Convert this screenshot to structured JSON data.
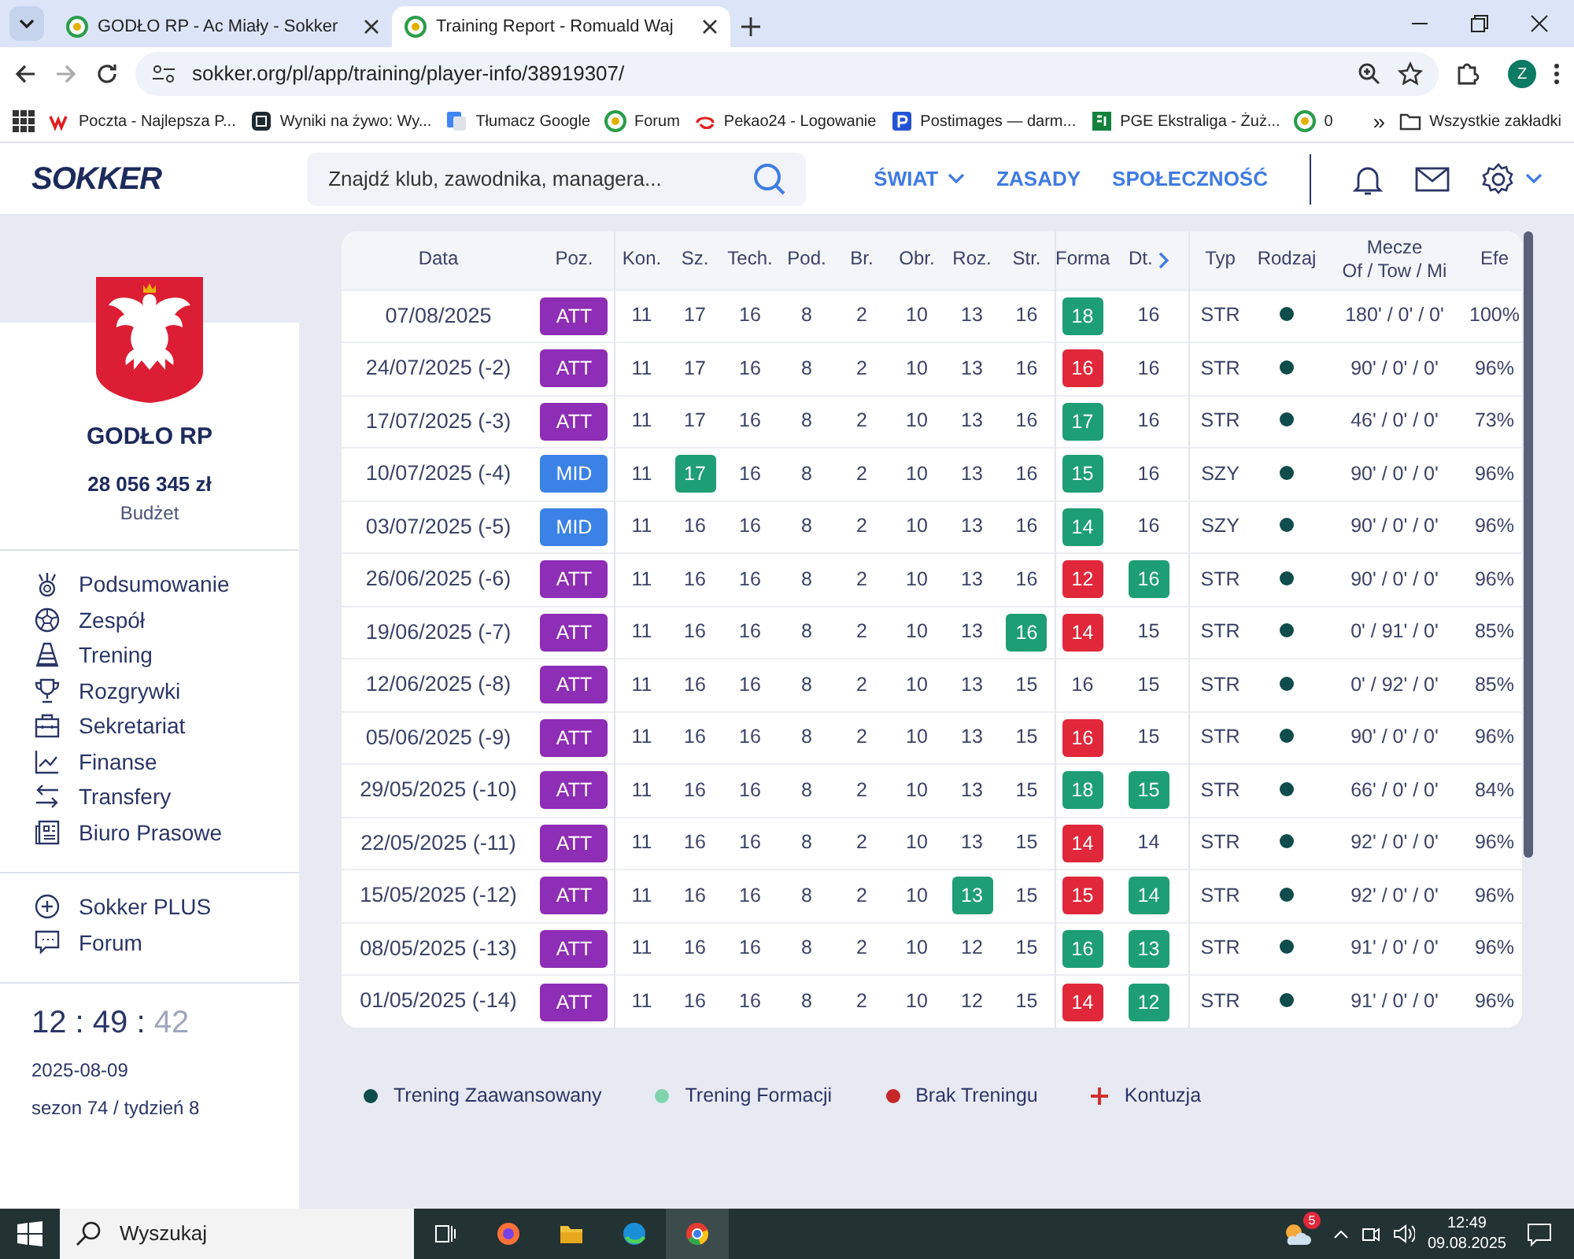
{
  "browser": {
    "tabs": [
      {
        "title": "GODŁO RP - Ac Miały - Sokker",
        "selected": false
      },
      {
        "title": "Training Report - Romuald Waj",
        "selected": true
      }
    ],
    "url": "sokker.org/pl/app/training/player-info/38919307/",
    "profile": "Z",
    "bookmarks": [
      "Poczta - Najlepsza P...",
      "Wyniki na żywo: Wy...",
      "Tłumacz Google",
      "Forum",
      "Pekao24 - Logowanie",
      "Postimages — darm...",
      "PGE Ekstraliga - Żuż...",
      "0"
    ],
    "more_bookmarks": "»",
    "all_bookmarks": "Wszystkie zakładki"
  },
  "header": {
    "logo": "SOKKER",
    "search_placeholder": "Znajdź klub, zawodnika, managera...",
    "nav": [
      {
        "label": "ŚWIAT",
        "dropdown": true
      },
      {
        "label": "ZASADY",
        "dropdown": false
      },
      {
        "label": "SPOŁECZNOŚĆ",
        "dropdown": false
      }
    ]
  },
  "sidebar": {
    "club": "GODŁO RP",
    "budget": "28 056 345 zł",
    "budget_label": "Budżet",
    "menu": [
      "Podsumowanie",
      "Zespół",
      "Trening",
      "Rozgrywki",
      "Sekretariat",
      "Finanse",
      "Transfery",
      "Biuro Prasowe"
    ],
    "extra_menu": [
      "Sokker PLUS",
      "Forum"
    ],
    "clock": {
      "hours": "12",
      "minutes": "49",
      "seconds": "42",
      "separator": ":"
    },
    "date": "2025-08-09",
    "season": "sezon 74 / tydzień 8"
  },
  "table": {
    "columns": [
      {
        "label": "Data"
      },
      {
        "label": "Poz."
      },
      {
        "label": "Kon."
      },
      {
        "label": "Sz."
      },
      {
        "label": "Tech."
      },
      {
        "label": "Pod."
      },
      {
        "label": "Br."
      },
      {
        "label": "Obr."
      },
      {
        "label": "Roz."
      },
      {
        "label": "Str."
      },
      {
        "label": "Forma"
      },
      {
        "label": "Dt.",
        "next_arrow": true
      },
      {
        "label": "Typ"
      },
      {
        "label": "Rodzaj"
      },
      {
        "label": "Mecze",
        "sublabel": "Of / Tow / Mi"
      },
      {
        "label": "Efe"
      }
    ],
    "rows": [
      {
        "date": "07/08/2025",
        "position": {
          "label": "ATT",
          "color": "#8e2db5"
        },
        "skills": [
          {
            "value": "11",
            "up": false,
            "down": false
          },
          {
            "value": "17",
            "up": false,
            "down": false
          },
          {
            "value": "16",
            "up": false,
            "down": false
          },
          {
            "value": "8",
            "up": false,
            "down": false
          },
          {
            "value": "2",
            "up": false,
            "down": false
          },
          {
            "value": "10",
            "up": false,
            "down": false
          },
          {
            "value": "13",
            "up": false,
            "down": false
          },
          {
            "value": "16",
            "up": false,
            "down": false
          },
          {
            "value": "18",
            "up": true,
            "down": false
          },
          {
            "value": "16",
            "up": false,
            "down": false
          }
        ],
        "type": "STR",
        "training": {
          "color": "#0f4c4c"
        },
        "matches": "180' / 0' / 0'",
        "efficiency": "100%"
      },
      {
        "date": "24/07/2025 (-2)",
        "position": {
          "label": "ATT",
          "color": "#8e2db5"
        },
        "skills": [
          {
            "value": "11",
            "up": false,
            "down": false
          },
          {
            "value": "17",
            "up": false,
            "down": false
          },
          {
            "value": "16",
            "up": false,
            "down": false
          },
          {
            "value": "8",
            "up": false,
            "down": false
          },
          {
            "value": "2",
            "up": false,
            "down": false
          },
          {
            "value": "10",
            "up": false,
            "down": false
          },
          {
            "value": "13",
            "up": false,
            "down": false
          },
          {
            "value": "16",
            "up": false,
            "down": false
          },
          {
            "value": "16",
            "up": false,
            "down": true
          },
          {
            "value": "16",
            "up": false,
            "down": false
          }
        ],
        "type": "STR",
        "training": {
          "color": "#0f4c4c"
        },
        "matches": "90' / 0' / 0'",
        "efficiency": "96%"
      },
      {
        "date": "17/07/2025 (-3)",
        "position": {
          "label": "ATT",
          "color": "#8e2db5"
        },
        "skills": [
          {
            "value": "11",
            "up": false,
            "down": false
          },
          {
            "value": "17",
            "up": false,
            "down": false
          },
          {
            "value": "16",
            "up": false,
            "down": false
          },
          {
            "value": "8",
            "up": false,
            "down": false
          },
          {
            "value": "2",
            "up": false,
            "down": false
          },
          {
            "value": "10",
            "up": false,
            "down": false
          },
          {
            "value": "13",
            "up": false,
            "down": false
          },
          {
            "value": "16",
            "up": false,
            "down": false
          },
          {
            "value": "17",
            "up": true,
            "down": false
          },
          {
            "value": "16",
            "up": false,
            "down": false
          }
        ],
        "type": "STR",
        "training": {
          "color": "#0f4c4c"
        },
        "matches": "46' / 0' / 0'",
        "efficiency": "73%"
      },
      {
        "date": "10/07/2025 (-4)",
        "position": {
          "label": "MID",
          "color": "#3b82e6"
        },
        "skills": [
          {
            "value": "11",
            "up": false,
            "down": false
          },
          {
            "value": "17",
            "up": true,
            "down": false
          },
          {
            "value": "16",
            "up": false,
            "down": false
          },
          {
            "value": "8",
            "up": false,
            "down": false
          },
          {
            "value": "2",
            "up": false,
            "down": false
          },
          {
            "value": "10",
            "up": false,
            "down": false
          },
          {
            "value": "13",
            "up": false,
            "down": false
          },
          {
            "value": "16",
            "up": false,
            "down": false
          },
          {
            "value": "15",
            "up": true,
            "down": false
          },
          {
            "value": "16",
            "up": false,
            "down": false
          }
        ],
        "type": "SZY",
        "training": {
          "color": "#0f4c4c"
        },
        "matches": "90' / 0' / 0'",
        "efficiency": "96%"
      },
      {
        "date": "03/07/2025 (-5)",
        "position": {
          "label": "MID",
          "color": "#3b82e6"
        },
        "skills": [
          {
            "value": "11",
            "up": false,
            "down": false
          },
          {
            "value": "16",
            "up": false,
            "down": false
          },
          {
            "value": "16",
            "up": false,
            "down": false
          },
          {
            "value": "8",
            "up": false,
            "down": false
          },
          {
            "value": "2",
            "up": false,
            "down": false
          },
          {
            "value": "10",
            "up": false,
            "down": false
          },
          {
            "value": "13",
            "up": false,
            "down": false
          },
          {
            "value": "16",
            "up": false,
            "down": false
          },
          {
            "value": "14",
            "up": true,
            "down": false
          },
          {
            "value": "16",
            "up": false,
            "down": false
          }
        ],
        "type": "SZY",
        "training": {
          "color": "#0f4c4c"
        },
        "matches": "90' / 0' / 0'",
        "efficiency": "96%"
      },
      {
        "date": "26/06/2025 (-6)",
        "position": {
          "label": "ATT",
          "color": "#8e2db5"
        },
        "skills": [
          {
            "value": "11",
            "up": false,
            "down": false
          },
          {
            "value": "16",
            "up": false,
            "down": false
          },
          {
            "value": "16",
            "up": false,
            "down": false
          },
          {
            "value": "8",
            "up": false,
            "down": false
          },
          {
            "value": "2",
            "up": false,
            "down": false
          },
          {
            "value": "10",
            "up": false,
            "down": false
          },
          {
            "value": "13",
            "up": false,
            "down": false
          },
          {
            "value": "16",
            "up": false,
            "down": false
          },
          {
            "value": "12",
            "up": false,
            "down": true
          },
          {
            "value": "16",
            "up": true,
            "down": false
          }
        ],
        "type": "STR",
        "training": {
          "color": "#0f4c4c"
        },
        "matches": "90' / 0' / 0'",
        "efficiency": "96%"
      },
      {
        "date": "19/06/2025 (-7)",
        "position": {
          "label": "ATT",
          "color": "#8e2db5"
        },
        "skills": [
          {
            "value": "11",
            "up": false,
            "down": false
          },
          {
            "value": "16",
            "up": false,
            "down": false
          },
          {
            "value": "16",
            "up": false,
            "down": false
          },
          {
            "value": "8",
            "up": false,
            "down": false
          },
          {
            "value": "2",
            "up": false,
            "down": false
          },
          {
            "value": "10",
            "up": false,
            "down": false
          },
          {
            "value": "13",
            "up": false,
            "down": false
          },
          {
            "value": "16",
            "up": true,
            "down": false
          },
          {
            "value": "14",
            "up": false,
            "down": true
          },
          {
            "value": "15",
            "up": false,
            "down": false
          }
        ],
        "type": "STR",
        "training": {
          "color": "#0f4c4c"
        },
        "matches": "0' / 91' / 0'",
        "efficiency": "85%"
      },
      {
        "date": "12/06/2025 (-8)",
        "position": {
          "label": "ATT",
          "color": "#8e2db5"
        },
        "skills": [
          {
            "value": "11",
            "up": false,
            "down": false
          },
          {
            "value": "16",
            "up": false,
            "down": false
          },
          {
            "value": "16",
            "up": false,
            "down": false
          },
          {
            "value": "8",
            "up": false,
            "down": false
          },
          {
            "value": "2",
            "up": false,
            "down": false
          },
          {
            "value": "10",
            "up": false,
            "down": false
          },
          {
            "value": "13",
            "up": false,
            "down": false
          },
          {
            "value": "15",
            "up": false,
            "down": false
          },
          {
            "value": "16",
            "up": false,
            "down": false
          },
          {
            "value": "15",
            "up": false,
            "down": false
          }
        ],
        "type": "STR",
        "training": {
          "color": "#0f4c4c"
        },
        "matches": "0' / 92' / 0'",
        "efficiency": "85%"
      },
      {
        "date": "05/06/2025 (-9)",
        "position": {
          "label": "ATT",
          "color": "#8e2db5"
        },
        "skills": [
          {
            "value": "11",
            "up": false,
            "down": false
          },
          {
            "value": "16",
            "up": false,
            "down": false
          },
          {
            "value": "16",
            "up": false,
            "down": false
          },
          {
            "value": "8",
            "up": false,
            "down": false
          },
          {
            "value": "2",
            "up": false,
            "down": false
          },
          {
            "value": "10",
            "up": false,
            "down": false
          },
          {
            "value": "13",
            "up": false,
            "down": false
          },
          {
            "value": "15",
            "up": false,
            "down": false
          },
          {
            "value": "16",
            "up": false,
            "down": true
          },
          {
            "value": "15",
            "up": false,
            "down": false
          }
        ],
        "type": "STR",
        "training": {
          "color": "#0f4c4c"
        },
        "matches": "90' / 0' / 0'",
        "efficiency": "96%"
      },
      {
        "date": "29/05/2025 (-10)",
        "position": {
          "label": "ATT",
          "color": "#8e2db5"
        },
        "skills": [
          {
            "value": "11",
            "up": false,
            "down": false
          },
          {
            "value": "16",
            "up": false,
            "down": false
          },
          {
            "value": "16",
            "up": false,
            "down": false
          },
          {
            "value": "8",
            "up": false,
            "down": false
          },
          {
            "value": "2",
            "up": false,
            "down": false
          },
          {
            "value": "10",
            "up": false,
            "down": false
          },
          {
            "value": "13",
            "up": false,
            "down": false
          },
          {
            "value": "15",
            "up": false,
            "down": false
          },
          {
            "value": "18",
            "up": true,
            "down": false
          },
          {
            "value": "15",
            "up": true,
            "down": false
          }
        ],
        "type": "STR",
        "training": {
          "color": "#0f4c4c"
        },
        "matches": "66' / 0' / 0'",
        "efficiency": "84%"
      },
      {
        "date": "22/05/2025 (-11)",
        "position": {
          "label": "ATT",
          "color": "#8e2db5"
        },
        "skills": [
          {
            "value": "11",
            "up": false,
            "down": false
          },
          {
            "value": "16",
            "up": false,
            "down": false
          },
          {
            "value": "16",
            "up": false,
            "down": false
          },
          {
            "value": "8",
            "up": false,
            "down": false
          },
          {
            "value": "2",
            "up": false,
            "down": false
          },
          {
            "value": "10",
            "up": false,
            "down": false
          },
          {
            "value": "13",
            "up": false,
            "down": false
          },
          {
            "value": "15",
            "up": false,
            "down": false
          },
          {
            "value": "14",
            "up": false,
            "down": true
          },
          {
            "value": "14",
            "up": false,
            "down": false
          }
        ],
        "type": "STR",
        "training": {
          "color": "#0f4c4c"
        },
        "matches": "92' / 0' / 0'",
        "efficiency": "96%"
      },
      {
        "date": "15/05/2025 (-12)",
        "position": {
          "label": "ATT",
          "color": "#8e2db5"
        },
        "skills": [
          {
            "value": "11",
            "up": false,
            "down": false
          },
          {
            "value": "16",
            "up": false,
            "down": false
          },
          {
            "value": "16",
            "up": false,
            "down": false
          },
          {
            "value": "8",
            "up": false,
            "down": false
          },
          {
            "value": "2",
            "up": false,
            "down": false
          },
          {
            "value": "10",
            "up": false,
            "down": false
          },
          {
            "value": "13",
            "up": true,
            "down": false
          },
          {
            "value": "15",
            "up": false,
            "down": false
          },
          {
            "value": "15",
            "up": false,
            "down": true
          },
          {
            "value": "14",
            "up": true,
            "down": false
          }
        ],
        "type": "STR",
        "training": {
          "color": "#0f4c4c"
        },
        "matches": "92' / 0' / 0'",
        "efficiency": "96%"
      },
      {
        "date": "08/05/2025 (-13)",
        "position": {
          "label": "ATT",
          "color": "#8e2db5"
        },
        "skills": [
          {
            "value": "11",
            "up": false,
            "down": false
          },
          {
            "value": "16",
            "up": false,
            "down": false
          },
          {
            "value": "16",
            "up": false,
            "down": false
          },
          {
            "value": "8",
            "up": false,
            "down": false
          },
          {
            "value": "2",
            "up": false,
            "down": false
          },
          {
            "value": "10",
            "up": false,
            "down": false
          },
          {
            "value": "12",
            "up": false,
            "down": false
          },
          {
            "value": "15",
            "up": false,
            "down": false
          },
          {
            "value": "16",
            "up": true,
            "down": false
          },
          {
            "value": "13",
            "up": true,
            "down": false
          }
        ],
        "type": "STR",
        "training": {
          "color": "#0f4c4c"
        },
        "matches": "91' / 0' / 0'",
        "efficiency": "96%"
      },
      {
        "date": "01/05/2025 (-14)",
        "position": {
          "label": "ATT",
          "color": "#8e2db5"
        },
        "skills": [
          {
            "value": "11",
            "up": false,
            "down": false
          },
          {
            "value": "16",
            "up": false,
            "down": false
          },
          {
            "value": "16",
            "up": false,
            "down": false
          },
          {
            "value": "8",
            "up": false,
            "down": false
          },
          {
            "value": "2",
            "up": false,
            "down": false
          },
          {
            "value": "10",
            "up": false,
            "down": false
          },
          {
            "value": "12",
            "up": false,
            "down": false
          },
          {
            "value": "15",
            "up": false,
            "down": false
          },
          {
            "value": "14",
            "up": false,
            "down": true
          },
          {
            "value": "12",
            "up": true,
            "down": false
          }
        ],
        "type": "STR",
        "training": {
          "color": "#0f4c4c"
        },
        "matches": "91' / 0' / 0'",
        "efficiency": "96%"
      }
    ]
  },
  "legend": [
    {
      "kind": "dot",
      "color": "#0f4c4c",
      "label": "Trening Zaawansowany"
    },
    {
      "kind": "dot",
      "color": "#7fd3ad",
      "label": "Trening Formacji"
    },
    {
      "kind": "dot",
      "color": "#c62828",
      "label": "Brak Treningu"
    },
    {
      "kind": "plus",
      "color": "#d32f2f",
      "label": "Kontuzja"
    }
  ],
  "taskbar": {
    "search_placeholder": "Wyszukaj",
    "weather_badge": "5",
    "time": "12:49",
    "date": "09.08.2025"
  }
}
